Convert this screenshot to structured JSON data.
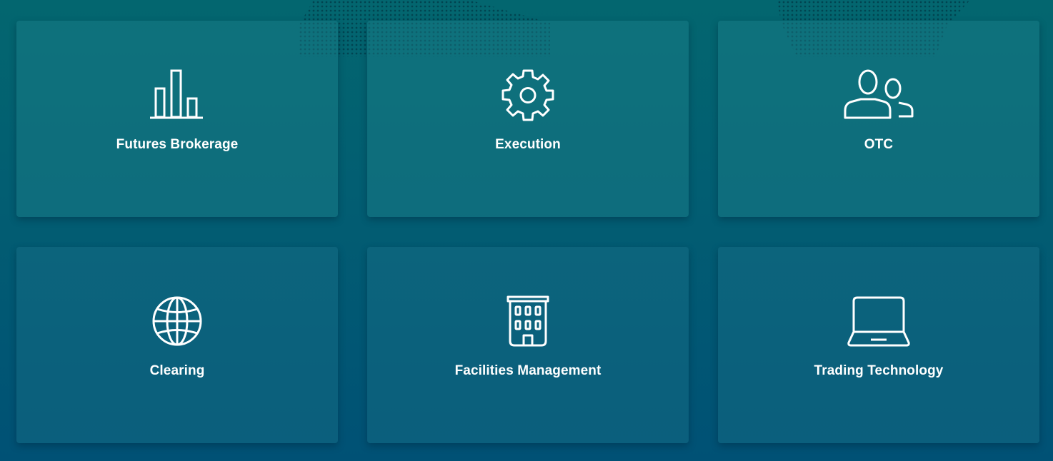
{
  "services": [
    {
      "id": "futures-brokerage",
      "label": "Futures Brokerage",
      "icon": "bar-chart-icon"
    },
    {
      "id": "execution",
      "label": "Execution",
      "icon": "gear-icon"
    },
    {
      "id": "otc",
      "label": "OTC",
      "icon": "users-icon"
    },
    {
      "id": "clearing",
      "label": "Clearing",
      "icon": "globe-icon"
    },
    {
      "id": "facilities-management",
      "label": "Facilities Management",
      "icon": "building-icon"
    },
    {
      "id": "trading-technology",
      "label": "Trading Technology",
      "icon": "laptop-icon"
    }
  ],
  "colors": {
    "background_top": "#03666f",
    "background_bottom": "#005175",
    "icon_stroke": "#ffffff",
    "text": "#ffffff"
  }
}
